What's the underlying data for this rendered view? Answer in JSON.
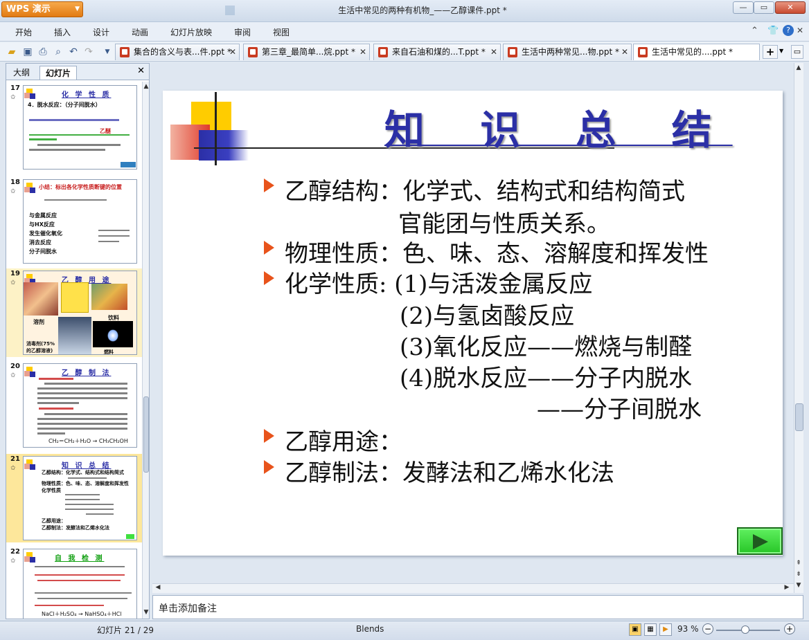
{
  "app": {
    "name": "WPS 演示",
    "window_title": "生活中常见的两种有机物_——乙醇课件.ppt *"
  },
  "menu": [
    "开始",
    "插入",
    "设计",
    "动画",
    "幻灯片放映",
    "审阅",
    "视图"
  ],
  "doc_tabs": [
    {
      "label": "集合的含义与表...件.ppt *",
      "active": false
    },
    {
      "label": "第三章_最简单...烷.ppt *",
      "active": false
    },
    {
      "label": "来自石油和煤的...T.ppt *",
      "active": false
    },
    {
      "label": "生活中两种常见...物.ppt *",
      "active": false
    },
    {
      "label": "生活中常见的....ppt *",
      "active": true
    }
  ],
  "side_panel": {
    "tabs": [
      "大纲",
      "幻灯片"
    ],
    "active_tab": "幻灯片",
    "thumbnails": [
      {
        "number": "17",
        "title": "化 学 性 质",
        "lines": [
          "4．脱水反应：（分子间脱水）",
          "乙醚"
        ]
      },
      {
        "number": "18",
        "title": "",
        "lines": [
          "小结：标出各化学性质断键的位置",
          "与金属反应",
          "与HX反应",
          "发生催化氧化",
          "消去反应",
          "分子间脱水"
        ]
      },
      {
        "number": "19",
        "title": "乙 醇 用 途",
        "lines": [
          "溶剂",
          "饮料",
          "消毒剂(75%的乙醇溶液)",
          "燃料"
        ]
      },
      {
        "number": "20",
        "title": "乙 醇 制 法",
        "lines": [
          "CH₂＝CH₂＋H₂O → CH₃CH₂OH"
        ]
      },
      {
        "number": "21",
        "title": "知 识 总 结",
        "lines": [
          "乙醇结构：化学式、结构式和结构简式",
          "物理性质：色、味、态、溶解度和挥发性",
          "化学性质",
          "乙醇用途：",
          "乙醇制法：发酵法和乙烯水化法"
        ]
      },
      {
        "number": "22",
        "title": "自 我 检 测",
        "lines": [
          "NaCl＋H₂SO₄ → NaHSO₄＋HCl"
        ]
      }
    ]
  },
  "slide": {
    "title": "知 识 总 结",
    "lines": [
      {
        "bullet": true,
        "text": "乙醇结构：化学式、结构式和结构简式"
      },
      {
        "bullet": false,
        "text": "官能团与性质关系。"
      },
      {
        "bullet": true,
        "text": "物理性质：色、味、态、溶解度和挥发性"
      },
      {
        "bullet": true,
        "text": "化学性质: (1)与活泼金属反应"
      },
      {
        "bullet": false,
        "text": "(2)与氢卤酸反应"
      },
      {
        "bullet": false,
        "text": "(3)氧化反应——燃烧与制醛"
      },
      {
        "bullet": false,
        "text": "(4)脱水反应——分子内脱水"
      },
      {
        "bullet": false,
        "text": "——分子间脱水"
      },
      {
        "bullet": true,
        "text": "乙醇用途："
      },
      {
        "bullet": true,
        "text": "乙醇制法：发酵法和乙烯水化法"
      }
    ]
  },
  "notes_placeholder": "单击添加备注",
  "status": {
    "slide_counter": "幻灯片 21 / 29",
    "theme": "Blends",
    "zoom": "93 %"
  }
}
